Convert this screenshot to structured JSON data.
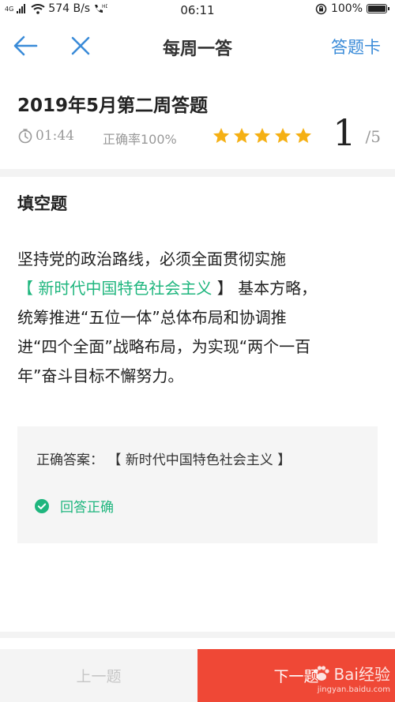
{
  "status_bar": {
    "network_tag": "4G",
    "speed": "574 B/s",
    "time": "06:11",
    "battery": "100%"
  },
  "nav": {
    "title": "每周一答",
    "answer_card": "答题卡"
  },
  "header": {
    "quiz_title": "2019年5月第二周答题",
    "timer": "01:44",
    "accuracy": "正确率100%",
    "stars": 5,
    "progress_current": "1",
    "progress_total": "/5"
  },
  "question": {
    "type": "填空题",
    "line1": "坚持党的政治路线，必须全面贯彻实施",
    "bracket_open": "【 ",
    "answer_text": "新时代中国特色社会主义",
    "bracket_close": " 】",
    "line2_rest": " 基本方略，",
    "line3": "统筹推进“五位一体”总体布局和协调推",
    "line4": "进“四个全面”战略布局，为实现“两个一百",
    "line5": "年”奋斗目标不懈努力。"
  },
  "answer_box": {
    "label": "正确答案：  【  新时代中国特色社会主义 】",
    "result": "回答正确"
  },
  "bottom": {
    "prev_label": "上一题",
    "next_label": "下一题",
    "watermark": "Bai经验",
    "watermark_sub": "jingyan.baidu.com"
  },
  "colors": {
    "accent_blue": "#3a8bd8",
    "star": "#f5b014",
    "correct_green": "#1fb67e",
    "next_red": "#ef4836"
  }
}
